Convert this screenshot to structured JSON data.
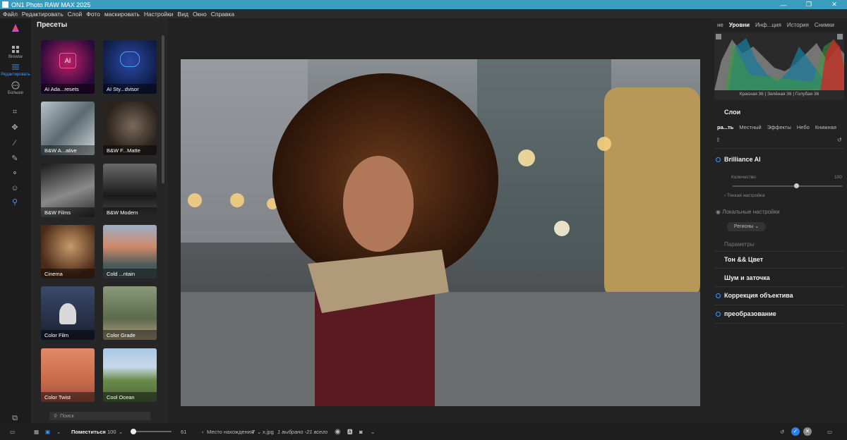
{
  "app": {
    "title": "ON1 Photo RAW MAX 2025"
  },
  "menu": [
    "Файл",
    "Редактировать",
    "Слой",
    "Фото",
    "маскировать",
    "Настройки",
    "Вид",
    "Окно",
    "Справка"
  ],
  "leftbar": {
    "browse": "Browse",
    "edit": "Редактировать",
    "more": "Больше"
  },
  "presets": {
    "title": "Пресеты",
    "tiles": [
      "AI Ada...resets",
      "AI Sty...dvisor",
      "B&W A...ative",
      "B&W F...Matte",
      "B&W Films",
      "B&W Modern",
      "Cinema",
      "Cold ...ntain",
      "Color Film",
      "Color Grade",
      "Color Twist",
      "Cool Ocean"
    ],
    "search_placeholder": "Поиск"
  },
  "right": {
    "tabs": [
      "не",
      "Уровни",
      "Инф...ция",
      "История",
      "Снимки"
    ],
    "histogram_legend": "Красная  36  | Зелёная  36  | Голубая  36",
    "layers": "Слои",
    "subtabs": [
      "ра...ть",
      "Местный",
      "Эффекты",
      "Небо",
      "Книжная"
    ],
    "brilliance": "Brilliance AI",
    "amount_label": "Количество",
    "amount_value": "100",
    "amount_level": 0.58,
    "fine_tune": "Тонкая настройка",
    "local": "Локальные настройки",
    "regions": "Регионы",
    "params": "Параметры",
    "tone_color": "Тон && Цвет",
    "noise_sharp": "Шум и заточка",
    "lens": "Коррекция объектива",
    "transform": "преобразование"
  },
  "bottom": {
    "fit": "Поместиться",
    "zoom": "100",
    "zoom_slider_value": "61",
    "location_label": "Место нахождения",
    "location_count": "7",
    "file": "x.jpg",
    "selection": "1 выбрано -21 всего"
  },
  "colors": {
    "accent": "#3d9bff",
    "titlebar": "#3a9dbc"
  }
}
